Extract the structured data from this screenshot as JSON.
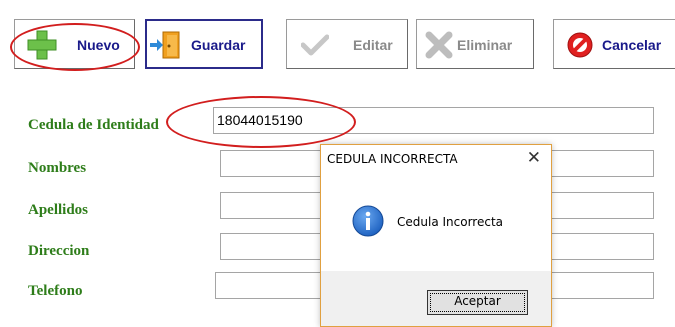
{
  "toolbar": {
    "nuevo": "Nuevo",
    "guardar": "Guardar",
    "editar": "Editar",
    "eliminar": "Eliminar",
    "cancelar": "Cancelar"
  },
  "form": {
    "cedula_label": "Cedula de Identidad",
    "cedula_value": "18044015190",
    "nombres_label": "Nombres",
    "apellidos_label": "Apellidos",
    "direccion_label": "Direccion",
    "telefono_label": "Telefono"
  },
  "dialog": {
    "title": "CEDULA INCORRECTA",
    "close": "✕",
    "message": "Cedula Incorrecta",
    "ok": "Aceptar"
  },
  "colors": {
    "label_green": "#2e7d1a",
    "annotation_red": "#d21e1e",
    "nuevo_text": "#1a1a8a"
  }
}
